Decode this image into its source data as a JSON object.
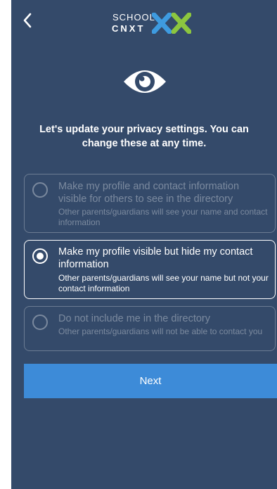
{
  "header": {
    "logo_school": "SCHOOL",
    "logo_cnxt": "CNXT"
  },
  "icons": {
    "back": "chevron-left-icon",
    "eye": "eye-icon",
    "logo_mark": "xx-logo-icon"
  },
  "colors": {
    "background": "#344a6a",
    "accent_button": "#3d8bd8",
    "logo_blue": "#3e9be0",
    "logo_green": "#8cc63f"
  },
  "intro": {
    "text": "Let's update your privacy settings. You can change these at any time."
  },
  "options": [
    {
      "title": "Make my profile and contact information visible for others to see in the directory",
      "description": "Other parents/guardians will see your name and contact information",
      "selected": false
    },
    {
      "title": "Make my profile visible but hide my contact information",
      "description": "Other parents/guardians will see your name but not your contact information",
      "selected": true
    },
    {
      "title": "Do not include me in the directory",
      "description": "Other parents/guardians will not be able to contact you",
      "selected": false
    }
  ],
  "next_button": {
    "label": "Next"
  }
}
